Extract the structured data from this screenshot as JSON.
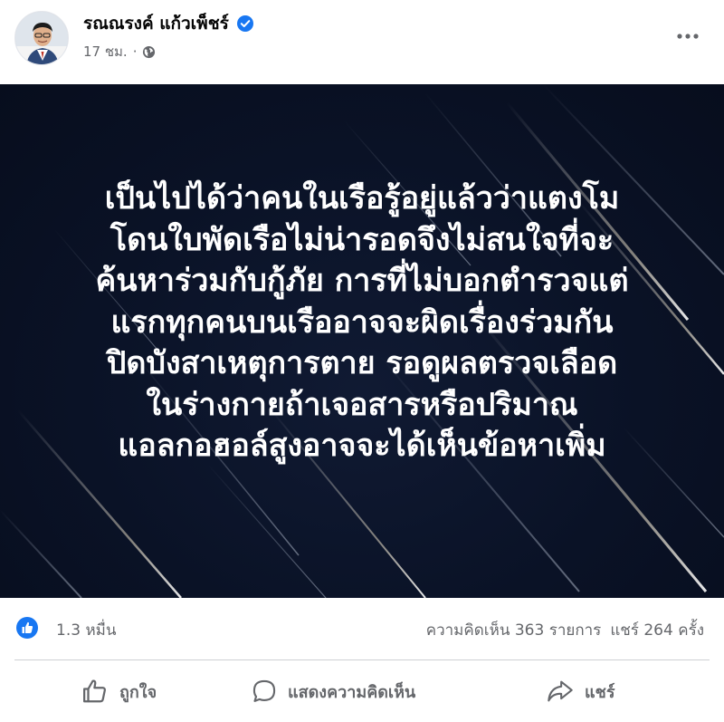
{
  "post": {
    "author": {
      "name": "รณณรงค์ แก้วเพ็ชร์",
      "verified": true
    },
    "time": "17 ชม.",
    "audience_icon": "globe-icon",
    "menu_icon": "more-icon"
  },
  "image": {
    "text_lines": [
      "เป็นไปได้ว่าคนในเรือรู้อยู่แล้วว่าแตงโม",
      "โดนใบพัดเรือไม่น่ารอดจึงไม่สนใจที่จะ",
      "ค้นหาร่วมกับกู้ภัย การที่ไม่บอกตำรวจแต่",
      "แรกทุกคนบนเรืออาจจะผิดเรื่องร่วมกัน",
      "ปิดบังสาเหตุการตาย รอดูผลตรวจเลือด",
      "ในร่างกายถ้าเจอสารหรือปริมาณ",
      "แอลกอฮอล์สูงอาจจะได้เห็นข้อหาเพิ่ม"
    ]
  },
  "stats": {
    "reactions": "1.3 หมื่น",
    "comments": "ความคิดเห็น 363 รายการ",
    "shares": "แชร์ 264 ครั้ง"
  },
  "actions": {
    "like_label": "ถูกใจ",
    "comment_label": "แสดงความคิดเห็น",
    "share_label": "แชร์"
  },
  "colors": {
    "verified_blue": "#1877f2",
    "secondary_text": "#65676b",
    "image_background": "#0a1226"
  }
}
